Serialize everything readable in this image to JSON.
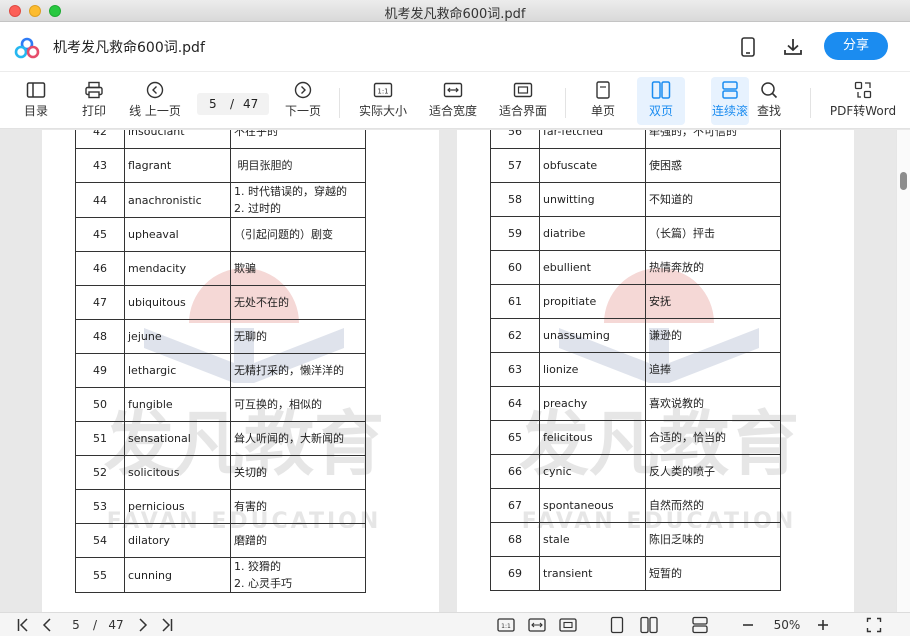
{
  "window": {
    "title": "机考发凡救命600词.pdf"
  },
  "app": {
    "doc_title": "机考发凡救命600词.pdf",
    "share_label": "分享",
    "accent": "#1b8cf0"
  },
  "toolbar": {
    "toc": "目录",
    "print": "打印",
    "prev_cut": "线",
    "prev": "上一页",
    "page_current": "5",
    "page_sep": "/",
    "page_total": "47",
    "next": "下一页",
    "actual_size": "实际大小",
    "fit_width": "适合宽度",
    "fit_page": "适合界面",
    "single": "单页",
    "double": "双页",
    "continuous": "连续滚",
    "find": "查找",
    "pdf_to_word": "PDF转Word"
  },
  "watermark": {
    "brand": "发凡教育",
    "brand_en": "FAVAN EDUCATION"
  },
  "pages": {
    "left": [
      {
        "num": "42",
        "word": "insouciant",
        "meaning": [
          "不在乎的"
        ]
      },
      {
        "num": "43",
        "word": "flagrant",
        "meaning": [
          " 明目张胆的"
        ]
      },
      {
        "num": "44",
        "word": "anachronistic",
        "meaning": [
          "1. 时代错误的，穿越的",
          "2. 过时的"
        ]
      },
      {
        "num": "45",
        "word": "upheaval",
        "meaning": [
          "（引起问题的）剧变"
        ]
      },
      {
        "num": "46",
        "word": "mendacity",
        "meaning": [
          "欺骗"
        ]
      },
      {
        "num": "47",
        "word": "ubiquitous",
        "meaning": [
          "无处不在的"
        ]
      },
      {
        "num": "48",
        "word": "jejune",
        "meaning": [
          "无聊的"
        ]
      },
      {
        "num": "49",
        "word": "lethargic",
        "meaning": [
          "无精打采的，懒洋洋的"
        ]
      },
      {
        "num": "50",
        "word": "fungible",
        "meaning": [
          "可互换的，相似的"
        ]
      },
      {
        "num": "51",
        "word": "sensational",
        "meaning": [
          "耸人听闻的，大新闻的"
        ]
      },
      {
        "num": "52",
        "word": "solicitous",
        "meaning": [
          "关切的"
        ]
      },
      {
        "num": "53",
        "word": "pernicious",
        "meaning": [
          "有害的"
        ]
      },
      {
        "num": "54",
        "word": "dilatory",
        "meaning": [
          "磨蹭的"
        ]
      },
      {
        "num": "55",
        "word": "cunning",
        "meaning": [
          "1. 狡猾的",
          "2. 心灵手巧"
        ]
      }
    ],
    "right": [
      {
        "num": "56",
        "word": "far-fetched",
        "meaning": [
          "牵强的，不可信的"
        ]
      },
      {
        "num": "57",
        "word": "obfuscate",
        "meaning": [
          "使困惑"
        ]
      },
      {
        "num": "58",
        "word": "unwitting",
        "meaning": [
          "不知道的"
        ]
      },
      {
        "num": "59",
        "word": "diatribe",
        "meaning": [
          "（长篇）抨击"
        ]
      },
      {
        "num": "60",
        "word": "ebullient",
        "meaning": [
          "热情奔放的"
        ]
      },
      {
        "num": "61",
        "word": "propitiate",
        "meaning": [
          "安抚"
        ]
      },
      {
        "num": "62",
        "word": "unassuming",
        "meaning": [
          "谦逊的"
        ]
      },
      {
        "num": "63",
        "word": "lionize",
        "meaning": [
          "追捧"
        ]
      },
      {
        "num": "64",
        "word": "preachy",
        "meaning": [
          "喜欢说教的"
        ]
      },
      {
        "num": "65",
        "word": "felicitous",
        "meaning": [
          "合适的，恰当的"
        ]
      },
      {
        "num": "66",
        "word": "cynic",
        "meaning": [
          "反人类的喷子"
        ]
      },
      {
        "num": "67",
        "word": "spontaneous",
        "meaning": [
          "自然而然的"
        ]
      },
      {
        "num": "68",
        "word": "stale",
        "meaning": [
          "陈旧乏味的"
        ]
      },
      {
        "num": "69",
        "word": "transient",
        "meaning": [
          "短暂的"
        ]
      }
    ]
  },
  "statusbar": {
    "page_current": "5",
    "page_sep": "/",
    "page_total": "47",
    "zoom": "50%"
  }
}
